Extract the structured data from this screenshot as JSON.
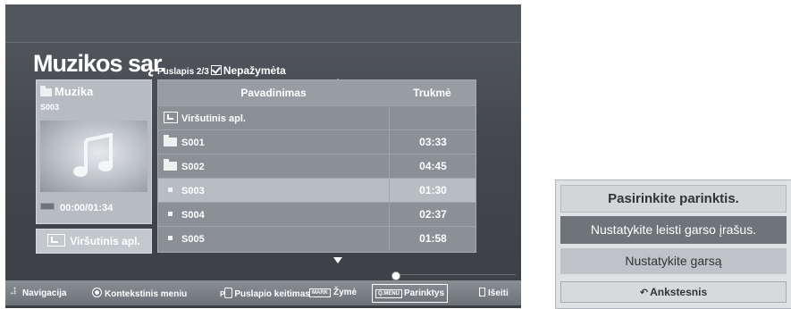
{
  "screen": {
    "title": "Muzikos sąr.",
    "page_info": "Puslapis 2/3",
    "unmarked_label": "Nepažymėta"
  },
  "info_panel": {
    "header": "Muzika",
    "file": "S003",
    "time": "00:00/01:34",
    "up_button": "Viršutinis apl."
  },
  "list": {
    "headers": {
      "name": "Pavadinimas",
      "duration": "Trukmė"
    },
    "rows": [
      {
        "name": "Viršutinis apl.",
        "duration": "",
        "icon": "folder-up-icon"
      },
      {
        "name": "S001",
        "duration": "03:33",
        "icon": "folder-icon"
      },
      {
        "name": "S002",
        "duration": "04:45",
        "icon": "folder-icon"
      },
      {
        "name": "S003",
        "duration": "01:30",
        "icon": "music-file-icon",
        "selected": true
      },
      {
        "name": "S004",
        "duration": "02:37",
        "icon": "music-file-icon"
      },
      {
        "name": "S005",
        "duration": "01:58",
        "icon": "music-file-icon"
      }
    ]
  },
  "bottom_bar": {
    "navigation": "Navigacija",
    "context_menu": "Kontekstinis meniu",
    "page_key": "P",
    "page_change": "Puslapio keitimas",
    "mark_key": "MARK",
    "mark": "Žymė",
    "qmenu_key": "Q.MENU",
    "options": "Parinktys",
    "exit": "Išeiti"
  },
  "popup": {
    "title": "Pasirinkite parinktis.",
    "option1": "Nustatykite leisti garso įrašus.",
    "option2": "Nustatykite garsą",
    "back": "Ankstesnis"
  },
  "colors": {
    "tv_background": "#44484e",
    "selected_row": "#b8bdc2",
    "popup_highlight": "#6f7479"
  }
}
